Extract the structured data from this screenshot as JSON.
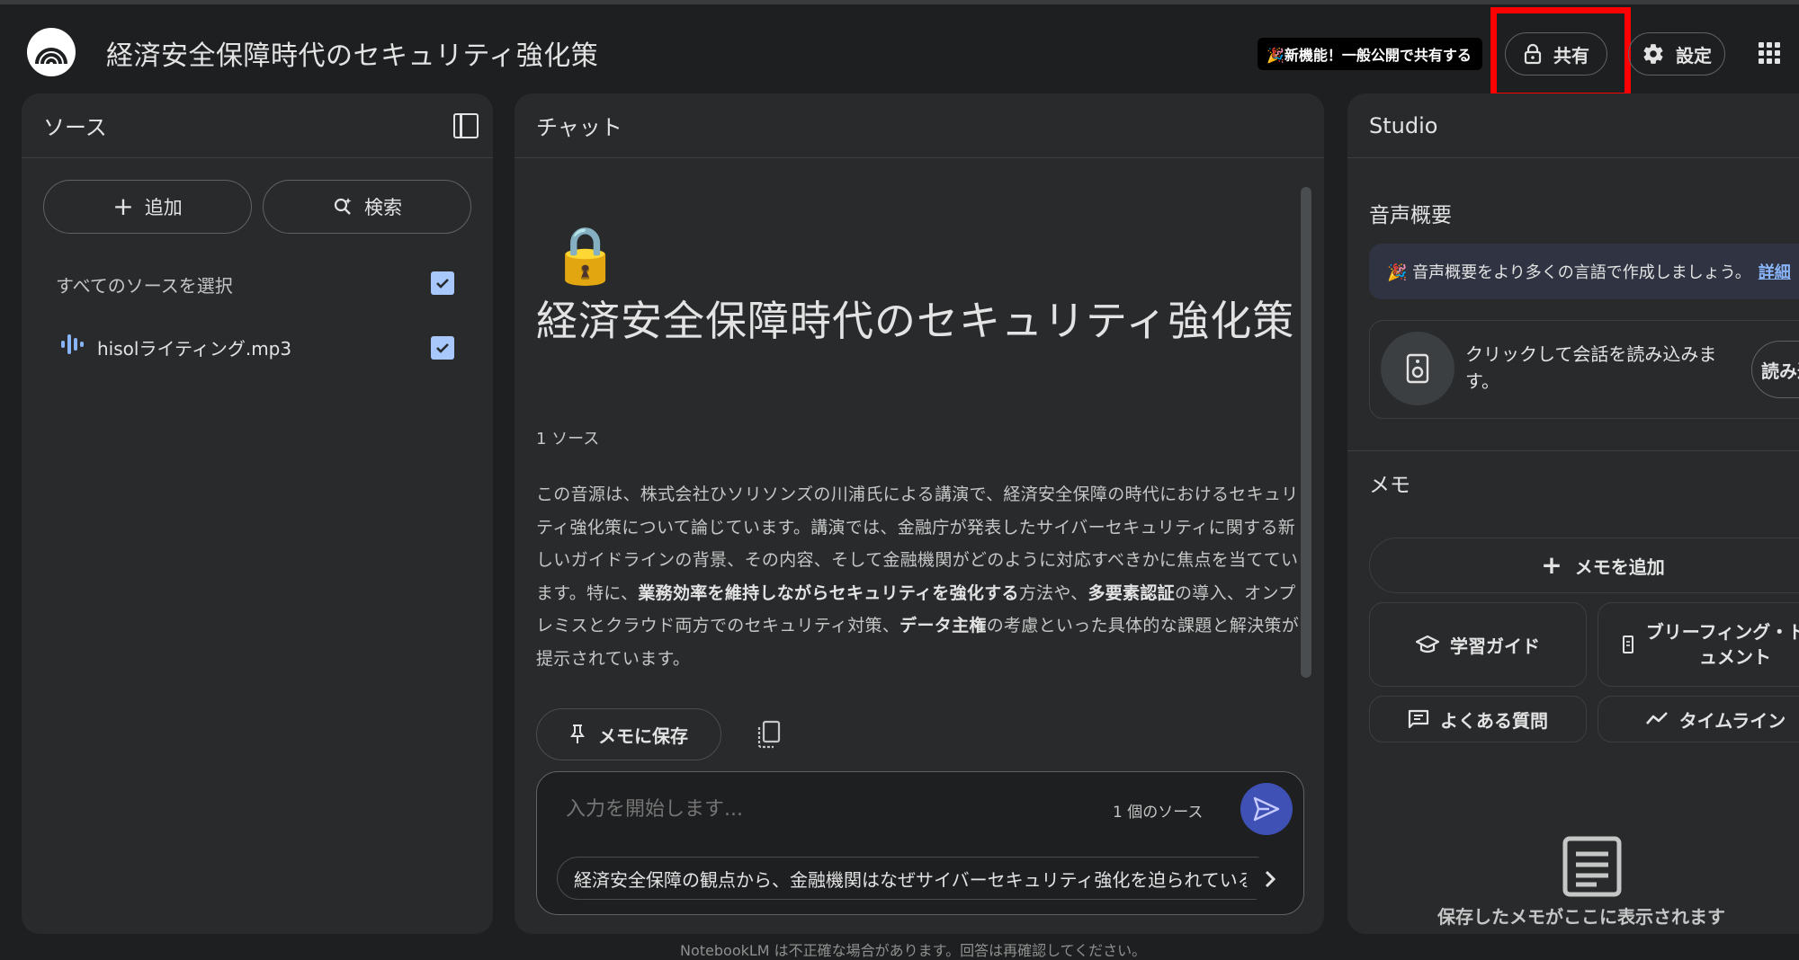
{
  "header": {
    "title": "経済安全保障時代のセキュリティ強化策",
    "promo": "🎉新機能！一般公開で共有する",
    "share_label": "共有",
    "settings_label": "設定"
  },
  "sources": {
    "title": "ソース",
    "add_label": "追加",
    "search_label": "検索",
    "select_all_label": "すべてのソースを選択",
    "items": [
      {
        "name": "hisolライティング.mp3"
      }
    ]
  },
  "chat": {
    "title": "チャット",
    "notebook_emoji": "🔒",
    "notebook_title": "経済安全保障時代のセキュリティ強化策",
    "source_count": "1 ソース",
    "summary_parts": [
      "この音源は、株式会社ひソリソンズの川浦氏による講演で、経済安全保障の時代におけるセキュリティ強化策について論じています。講演では、金融庁が発表したサイバーセキュリティに関する新しいガイドラインの背景、その内容、そして金融機関がどのように対応すべきかに焦点を当てています。特に、",
      "業務効率を維持しながらセキュリティを強化する",
      "方法や、",
      "多要素認証",
      "の導入、オンプレミスとクラウド両方でのセキュリティ対策、",
      "データ主権",
      "の考慮といった具体的な課題と解決策が提示されています。"
    ],
    "save_note_label": "メモに保存",
    "input_placeholder": "入力を開始します...",
    "input_source_count": "1 個のソース",
    "suggestion": "経済安全保障の観点から、金融機関はなぜサイバーセキュリティ強化を迫られているのか",
    "disclaimer": "NotebookLM は不正確な場合があります。回答は再確認してください。"
  },
  "studio": {
    "title": "Studio",
    "audio_title": "音声概要",
    "audio_banner": "🎉 音声概要をより多くの言語で作成しましょう。",
    "audio_banner_link": "詳細",
    "audio_load_text": "クリックして会話を読み込みます。",
    "audio_load_button": "読み込",
    "memo_title": "メモ",
    "add_memo_label": "メモを追加",
    "study_guide_label": "学習ガイド",
    "briefing_label": "ブリーフィング・ドキュメント",
    "faq_label": "よくある質問",
    "timeline_label": "タイムライン",
    "empty_memo_text": "保存したメモがここに表示されます"
  },
  "colors": {
    "background": "#1e1f20",
    "panel": "#282a2c",
    "highlight": "#ff0000",
    "send": "#3f51b5",
    "checkbox": "#a8c7fa"
  }
}
